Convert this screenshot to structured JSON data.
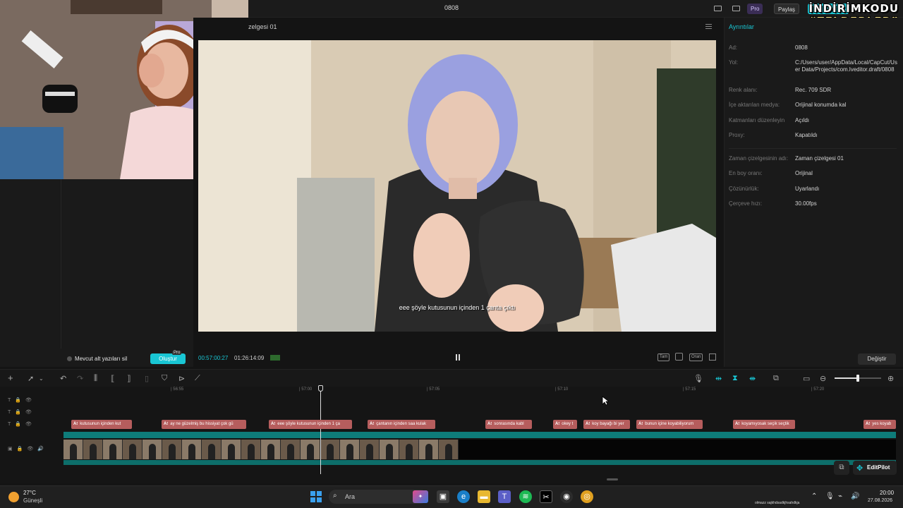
{
  "window": {
    "title": "0808",
    "pro_label": "Pro",
    "share_label": "Paylaş",
    "export_label": "Dışa aktar"
  },
  "overlay": {
    "line1": "İNDİRİMKODU",
    "line2": "“ZELDERLER”"
  },
  "player": {
    "timeline_name": "zelgesi 01",
    "subtitle": "eee şöyle kutusunun içinden 1 çanta çıktı",
    "time_current": "00:57:00:27",
    "time_total": "01:26:14:09",
    "icon_labels": [
      "Tam",
      "Oran"
    ]
  },
  "left_panel": {
    "remove_subtitles_label": "Mevcut alt yazıları sil",
    "create_button": "Oluştur",
    "create_badge": "Pro"
  },
  "details": {
    "tab": "Ayrıntılar",
    "rows": [
      {
        "label": "Ad:",
        "value": "0808"
      },
      {
        "label": "Yol:",
        "value": "C:/Users/user/AppData/Local/CapCut/User Data/Projects/com.lveditor.draft/0808"
      },
      {
        "label": "Renk alanı:",
        "value": "Rec. 709 SDR"
      },
      {
        "label": "İçe aktarılan medya:",
        "value": "Orijinal konumda kal"
      },
      {
        "label": "Katmanları düzenleyin",
        "value": "Açıldı"
      },
      {
        "label": "Proxy:",
        "value": "Kapatıldı"
      },
      {
        "label": "Zaman çizelgesinin adı:",
        "value": "Zaman çizelgesi 01"
      },
      {
        "label": "En boy oranı:",
        "value": "Orijinal"
      },
      {
        "label": "Çözünürlük:",
        "value": "Uyarlandı"
      },
      {
        "label": "Çerçeve hızı:",
        "value": "30.00fps"
      }
    ],
    "change_button": "Değiştir"
  },
  "timeline": {
    "ruler": [
      "56:55",
      "57:00",
      "57:05",
      "57:10",
      "57:15",
      "57:20"
    ],
    "zoom_level": 0.5,
    "subtitle_clips": [
      "kutusunun içinden kut",
      "ay ne güzelmiş bu hissiyat çok gü",
      "eee şöyle kutusunun içinden 1 ça",
      "çantanın içinden saa kulak",
      "sonrasında kabl",
      "okey t",
      "koy bayağı bi yer",
      "bunun içine koyabiliyorum",
      "koyamıyosak seçik seçtik",
      "yes koyab"
    ],
    "editpilot_label": "EditPilot"
  },
  "taskbar": {
    "temperature": "27°C",
    "weather": "Güneşli",
    "search_placeholder": "Ara",
    "ticker": "olmazz sajkhdsadkjhsahdkja",
    "time": "20:00",
    "date": "27.08.2026"
  },
  "colors": {
    "accent": "#19c6d4",
    "subtitle_clip": "#b65d5d",
    "video_track": "#0e7c7a"
  }
}
